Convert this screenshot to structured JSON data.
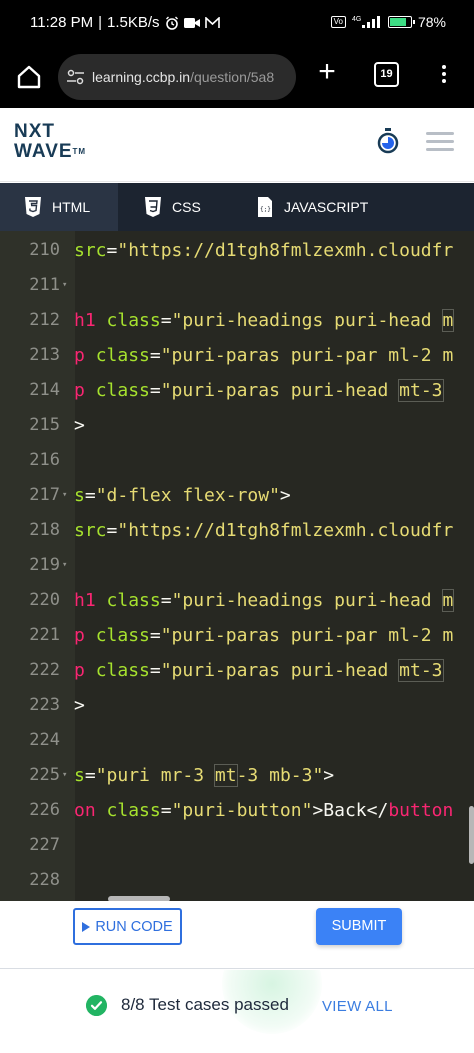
{
  "status_bar": {
    "time": "11:28 PM",
    "speed": "1.5KB/s",
    "separator": "|",
    "network": "4G",
    "battery": "78%",
    "battery_level": 0.78,
    "icons": [
      "alarm-icon",
      "video-icon",
      "mail-icon",
      "volte-icon",
      "signal-icon",
      "battery-icon"
    ]
  },
  "browser": {
    "url_host": "learning.ccbp.in",
    "url_path": "/question/5a8",
    "tab_count": "19"
  },
  "app": {
    "logo_line1": "NXT",
    "logo_line2": "WAVE",
    "logo_tm": "TM",
    "brand_color": "#183b56"
  },
  "tabs": [
    {
      "label": "HTML",
      "active": true
    },
    {
      "label": "CSS",
      "active": false
    },
    {
      "label": "JAVASCRIPT",
      "active": false
    }
  ],
  "editor": {
    "lines": [
      {
        "num": "210",
        "fold": "",
        "tokens": [
          [
            "attr",
            "src"
          ],
          [
            "txt",
            "="
          ],
          [
            "str",
            "\"https://d1tgh8fmlzexmh.cloudfr"
          ]
        ]
      },
      {
        "num": "211",
        "fold": "▾",
        "tokens": []
      },
      {
        "num": "212",
        "fold": "",
        "tokens": [
          [
            "tag",
            "h1"
          ],
          [
            "txt",
            " "
          ],
          [
            "attr",
            "class"
          ],
          [
            "txt",
            "="
          ],
          [
            "str",
            "\"puri-headings puri-head "
          ],
          [
            "str",
            "m"
          ]
        ]
      },
      {
        "num": "213",
        "fold": "",
        "tokens": [
          [
            "tag",
            "p"
          ],
          [
            "txt",
            " "
          ],
          [
            "attr",
            "class"
          ],
          [
            "txt",
            "="
          ],
          [
            "str",
            "\"puri-paras puri-par ml-2 m"
          ]
        ]
      },
      {
        "num": "214",
        "fold": "",
        "tokens": [
          [
            "tag",
            "p"
          ],
          [
            "txt",
            " "
          ],
          [
            "attr",
            "class"
          ],
          [
            "txt",
            "="
          ],
          [
            "str",
            "\"puri-paras puri-head "
          ],
          [
            "str",
            "mt-3"
          ]
        ]
      },
      {
        "num": "215",
        "fold": "",
        "tokens": [
          [
            "txt",
            ">"
          ]
        ]
      },
      {
        "num": "216",
        "fold": "",
        "tokens": []
      },
      {
        "num": "217",
        "fold": "▾",
        "tokens": [
          [
            "attr",
            "s"
          ],
          [
            "txt",
            "="
          ],
          [
            "str",
            "\"d-flex flex-row\""
          ],
          [
            "txt",
            ">"
          ]
        ]
      },
      {
        "num": "218",
        "fold": "",
        "tokens": [
          [
            "attr",
            "src"
          ],
          [
            "txt",
            "="
          ],
          [
            "str",
            "\"https://d1tgh8fmlzexmh.cloudfr"
          ]
        ]
      },
      {
        "num": "219",
        "fold": "▾",
        "tokens": []
      },
      {
        "num": "220",
        "fold": "",
        "tokens": [
          [
            "tag",
            "h1"
          ],
          [
            "txt",
            " "
          ],
          [
            "attr",
            "class"
          ],
          [
            "txt",
            "="
          ],
          [
            "str",
            "\"puri-headings puri-head "
          ],
          [
            "str",
            "m"
          ]
        ]
      },
      {
        "num": "221",
        "fold": "",
        "tokens": [
          [
            "tag",
            "p"
          ],
          [
            "txt",
            " "
          ],
          [
            "attr",
            "class"
          ],
          [
            "txt",
            "="
          ],
          [
            "str",
            "\"puri-paras puri-par ml-2 m"
          ]
        ]
      },
      {
        "num": "222",
        "fold": "",
        "tokens": [
          [
            "tag",
            "p"
          ],
          [
            "txt",
            " "
          ],
          [
            "attr",
            "class"
          ],
          [
            "txt",
            "="
          ],
          [
            "str",
            "\"puri-paras puri-head "
          ],
          [
            "str",
            "mt-3"
          ]
        ]
      },
      {
        "num": "223",
        "fold": "",
        "tokens": [
          [
            "txt",
            ">"
          ]
        ]
      },
      {
        "num": "224",
        "fold": "",
        "tokens": []
      },
      {
        "num": "225",
        "fold": "▾",
        "tokens": [
          [
            "attr",
            "s"
          ],
          [
            "txt",
            "="
          ],
          [
            "str",
            "\"puri mr-3 "
          ],
          [
            "str",
            "mt"
          ],
          [
            "str",
            "-3 mb-3\""
          ],
          [
            "txt",
            ">"
          ]
        ]
      },
      {
        "num": "226",
        "fold": "",
        "tokens": [
          [
            "tag",
            "on"
          ],
          [
            "txt",
            " "
          ],
          [
            "attr",
            "class"
          ],
          [
            "txt",
            "="
          ],
          [
            "str",
            "\"puri-button\""
          ],
          [
            "txt",
            ">Back</"
          ],
          [
            "tag",
            "button"
          ]
        ]
      },
      {
        "num": "227",
        "fold": "",
        "tokens": []
      },
      {
        "num": "228",
        "fold": "",
        "tokens": []
      }
    ]
  },
  "actions": {
    "run_label": "RUN CODE",
    "submit_label": "SUBMIT"
  },
  "result": {
    "text": "8/8 Test cases passed",
    "view_all": "VIEW ALL"
  }
}
